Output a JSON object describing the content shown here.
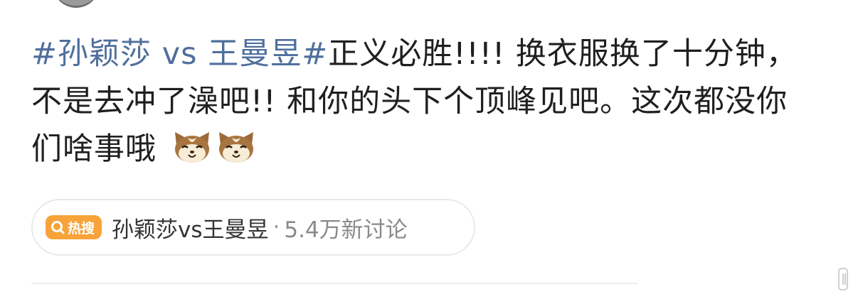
{
  "post": {
    "hashtag_start": "#孙颖莎 vs 王曼昱#",
    "body": "正义必胜!!!!  换衣服换了十分钟，不是去冲了澡吧!!  和你的头下个顶峰见吧。这次都没你们啥事哦",
    "emojis": [
      "cat-face-icon",
      "cat-face-icon"
    ]
  },
  "hot_search": {
    "badge_label": "热搜",
    "topic": "孙颖莎vs王曼昱",
    "separator": "·",
    "count": "5.4万新讨论"
  },
  "colors": {
    "hashtag": "#4f6f9d",
    "badge": "#f7a33a",
    "text": "#1f1f1f",
    "muted": "#8a8a8a"
  }
}
